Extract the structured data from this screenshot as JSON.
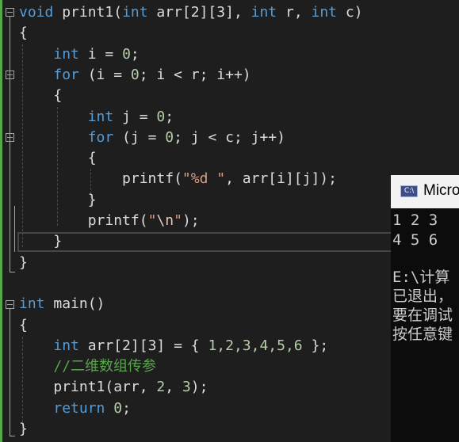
{
  "editor": {
    "lines": [
      {
        "parts": [
          {
            "t": "void",
            "c": "k"
          },
          {
            "t": " print1(",
            "c": "n"
          },
          {
            "t": "int",
            "c": "k"
          },
          {
            "t": " arr[2][3], ",
            "c": "n"
          },
          {
            "t": "int",
            "c": "k"
          },
          {
            "t": " r, ",
            "c": "n"
          },
          {
            "t": "int",
            "c": "k"
          },
          {
            "t": " c)",
            "c": "n"
          }
        ]
      },
      {
        "parts": [
          {
            "t": "{",
            "c": "n"
          }
        ]
      },
      {
        "parts": [
          {
            "t": "    ",
            "c": "n"
          },
          {
            "t": "int",
            "c": "k"
          },
          {
            "t": " i = ",
            "c": "n"
          },
          {
            "t": "0",
            "c": "num"
          },
          {
            "t": ";",
            "c": "n"
          }
        ]
      },
      {
        "parts": [
          {
            "t": "    ",
            "c": "n"
          },
          {
            "t": "for",
            "c": "k"
          },
          {
            "t": " (i = ",
            "c": "n"
          },
          {
            "t": "0",
            "c": "num"
          },
          {
            "t": "; i < r; i++)",
            "c": "n"
          }
        ]
      },
      {
        "parts": [
          {
            "t": "    {",
            "c": "n"
          }
        ]
      },
      {
        "parts": [
          {
            "t": "        ",
            "c": "n"
          },
          {
            "t": "int",
            "c": "k"
          },
          {
            "t": " j = ",
            "c": "n"
          },
          {
            "t": "0",
            "c": "num"
          },
          {
            "t": ";",
            "c": "n"
          }
        ]
      },
      {
        "parts": [
          {
            "t": "        ",
            "c": "n"
          },
          {
            "t": "for",
            "c": "k"
          },
          {
            "t": " (j = ",
            "c": "n"
          },
          {
            "t": "0",
            "c": "num"
          },
          {
            "t": "; j < c; j++)",
            "c": "n"
          }
        ]
      },
      {
        "parts": [
          {
            "t": "        {",
            "c": "n"
          }
        ]
      },
      {
        "parts": [
          {
            "t": "            printf(",
            "c": "n"
          },
          {
            "t": "\"%d \"",
            "c": "str"
          },
          {
            "t": ", arr[i][j]);",
            "c": "n"
          }
        ]
      },
      {
        "parts": [
          {
            "t": "        }",
            "c": "n"
          }
        ]
      },
      {
        "parts": [
          {
            "t": "        printf(",
            "c": "n"
          },
          {
            "t": "\"",
            "c": "str"
          },
          {
            "t": "\\n",
            "c": "esc"
          },
          {
            "t": "\"",
            "c": "str"
          },
          {
            "t": ");",
            "c": "n"
          }
        ]
      },
      {
        "parts": [
          {
            "t": "    }",
            "c": "n"
          }
        ]
      },
      {
        "parts": [
          {
            "t": "}",
            "c": "n"
          }
        ]
      },
      {
        "parts": []
      },
      {
        "parts": [
          {
            "t": "int",
            "c": "k"
          },
          {
            "t": " main()",
            "c": "n"
          }
        ]
      },
      {
        "parts": [
          {
            "t": "{",
            "c": "n"
          }
        ]
      },
      {
        "parts": [
          {
            "t": "    ",
            "c": "n"
          },
          {
            "t": "int",
            "c": "k"
          },
          {
            "t": " arr[2][3] = { ",
            "c": "n"
          },
          {
            "t": "1,2,3,4,5,6",
            "c": "num"
          },
          {
            "t": " };",
            "c": "n"
          }
        ]
      },
      {
        "parts": [
          {
            "t": "    ",
            "c": "n"
          },
          {
            "t": "//二维数组传参",
            "c": "com"
          }
        ]
      },
      {
        "parts": [
          {
            "t": "    print1(arr, ",
            "c": "n"
          },
          {
            "t": "2",
            "c": "num"
          },
          {
            "t": ", ",
            "c": "n"
          },
          {
            "t": "3",
            "c": "num"
          },
          {
            "t": ");",
            "c": "n"
          }
        ]
      },
      {
        "parts": [
          {
            "t": "    ",
            "c": "n"
          },
          {
            "t": "return",
            "c": "k"
          },
          {
            "t": " ",
            "c": "n"
          },
          {
            "t": "0",
            "c": "num"
          },
          {
            "t": ";",
            "c": "n"
          }
        ]
      },
      {
        "parts": [
          {
            "t": "}",
            "c": "n"
          }
        ]
      }
    ]
  },
  "console": {
    "title": "Micro",
    "icon": "console-app-icon",
    "icon_label": "C:\\",
    "lines": [
      "1 2 3",
      "4 5 6",
      "",
      "E:\\计算",
      "已退出，",
      "要在调试",
      "按任意键"
    ]
  },
  "colors": {
    "background": "#1e1e1e",
    "keyword": "#569cd6",
    "text": "#dcdcdc",
    "number": "#b5cea8",
    "string": "#d69d85",
    "comment": "#57a64a",
    "console_bg": "#0c0c0c",
    "console_titlebar": "#f2f2f2"
  }
}
